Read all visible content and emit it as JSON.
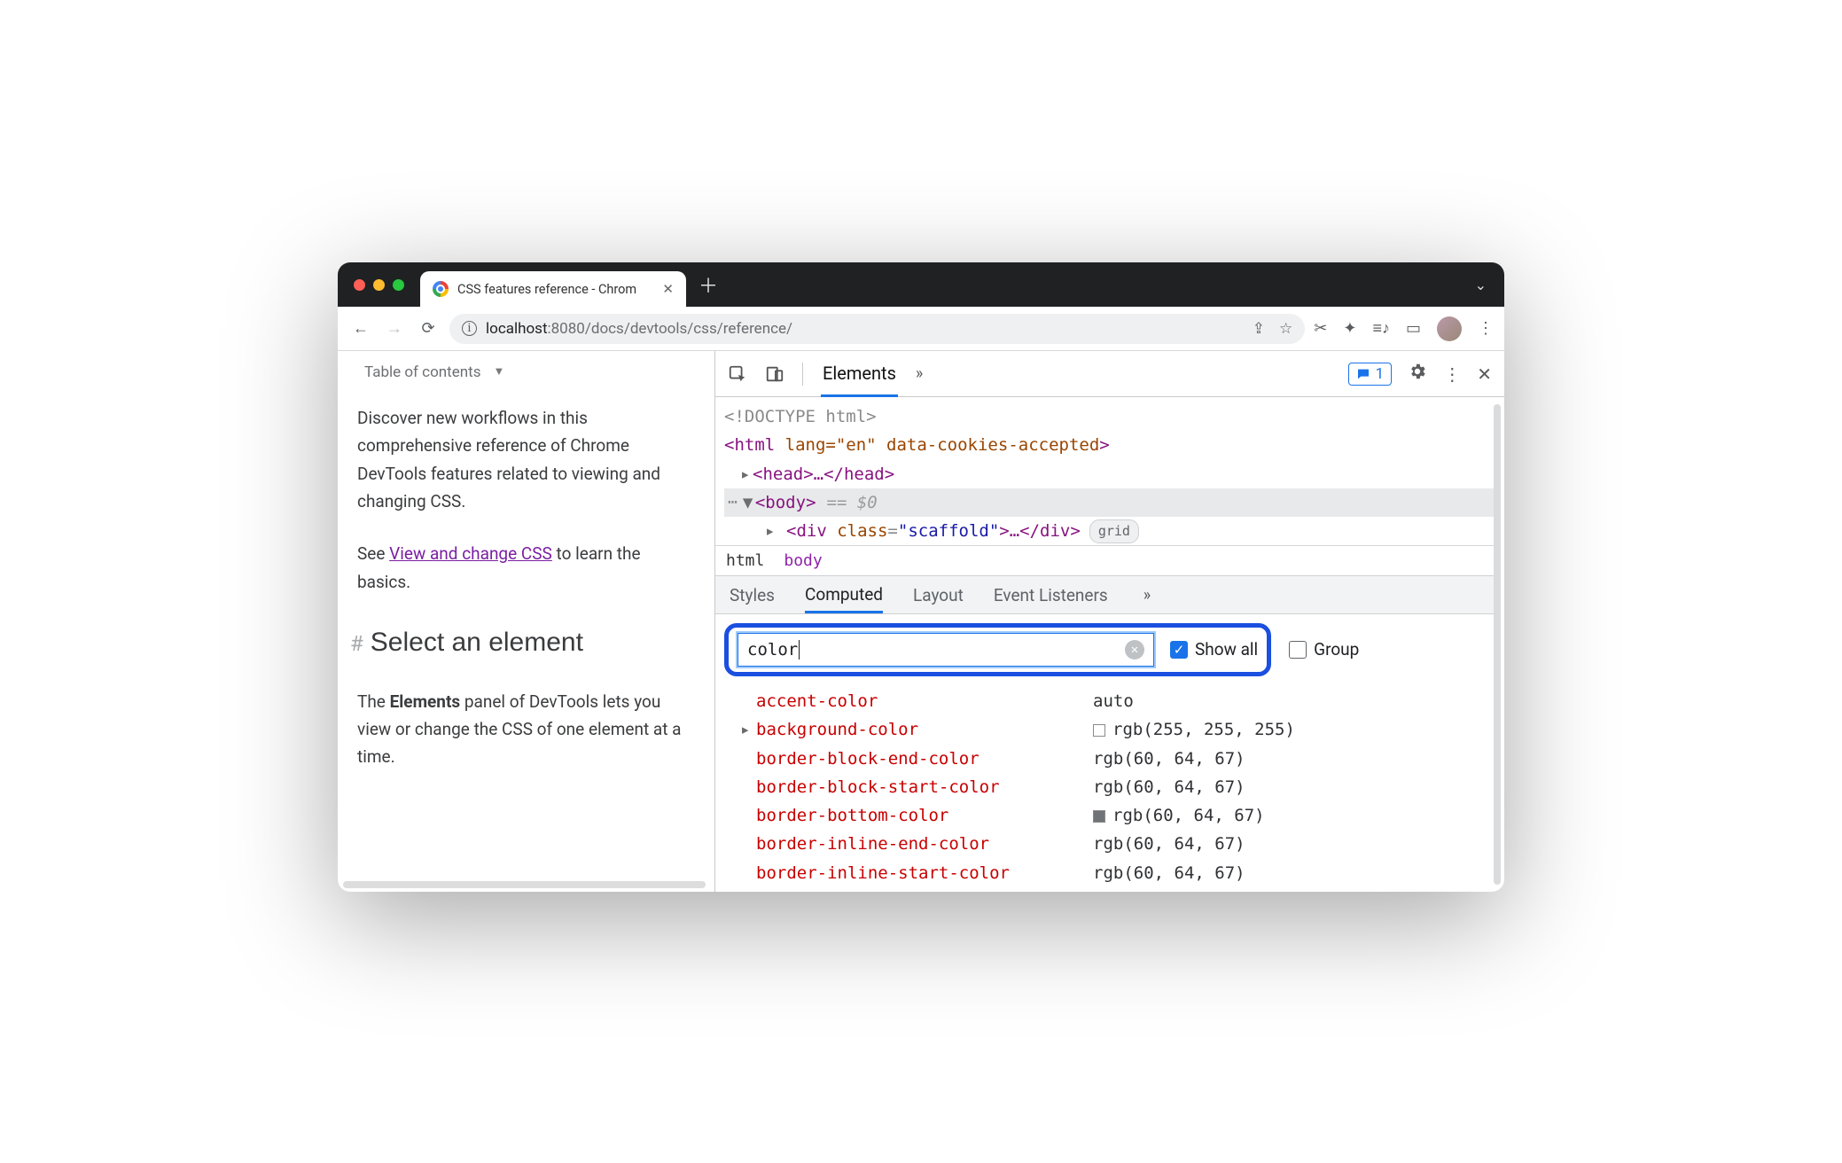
{
  "window": {
    "tab_title": "CSS features reference - Chrom",
    "new_tab_glyph": "＋",
    "chevron_glyph": "⌄"
  },
  "toolbar": {
    "back": "←",
    "fwd": "→",
    "reload": "⟳",
    "host": "localhost",
    "port_path": ":8080/docs/devtools/css/reference/",
    "share": "⇪",
    "star": "☆",
    "scissors": "✂︎",
    "ext": "✦",
    "readlist": "≡♪",
    "panel": "▭",
    "kebab": "⋮"
  },
  "page": {
    "toc_label": "Table of contents",
    "p1": "Discover new workflows in this comprehensive reference of Chrome DevTools features related to viewing and changing CSS.",
    "p2_a": "See ",
    "p2_link": "View and change CSS",
    "p2_b": " to learn the basics.",
    "heading": "Select an element",
    "p3_a": "The ",
    "p3_bold": "Elements",
    "p3_b": " panel of DevTools lets you view or change the CSS of one element at a time."
  },
  "devtools": {
    "tabs": {
      "elements": "Elements"
    },
    "badge_count": "1",
    "dom": {
      "doctype": "<!DOCTYPE html>",
      "html_open": "<",
      "html_tag": "html",
      "html_attrs": " lang=\"en\" data-cookies-accepted",
      "html_close": ">",
      "head": "<head>…</head>",
      "body_tag": "body",
      "eq0": "== $0",
      "div_line_a": "<",
      "div_tag": "div",
      "div_attr_name": " class",
      "div_attr_eq": "=",
      "div_attr_val": "\"scaffold\"",
      "div_line_b": ">…</",
      "div_line_c": ">",
      "grid_pill": "grid"
    },
    "crumbs": {
      "a": "html",
      "b": "body"
    },
    "subtabs": {
      "styles": "Styles",
      "computed": "Computed",
      "layout": "Layout",
      "listeners": "Event Listeners"
    },
    "filter": {
      "value": "color",
      "show_all": "Show all",
      "group": "Group"
    },
    "props": [
      {
        "name": "accent-color",
        "value": "auto",
        "tri": "",
        "sw": ""
      },
      {
        "name": "background-color",
        "value": "rgb(255, 255, 255)",
        "tri": "▸",
        "sw": "white"
      },
      {
        "name": "border-block-end-color",
        "value": "rgb(60, 64, 67)",
        "tri": "",
        "sw": ""
      },
      {
        "name": "border-block-start-color",
        "value": "rgb(60, 64, 67)",
        "tri": "",
        "sw": ""
      },
      {
        "name": "border-bottom-color",
        "value": "rgb(60, 64, 67)",
        "tri": "",
        "sw": "gray"
      },
      {
        "name": "border-inline-end-color",
        "value": "rgb(60, 64, 67)",
        "tri": "",
        "sw": ""
      },
      {
        "name": "border-inline-start-color",
        "value": "rgb(60, 64, 67)",
        "tri": "",
        "sw": ""
      }
    ]
  }
}
